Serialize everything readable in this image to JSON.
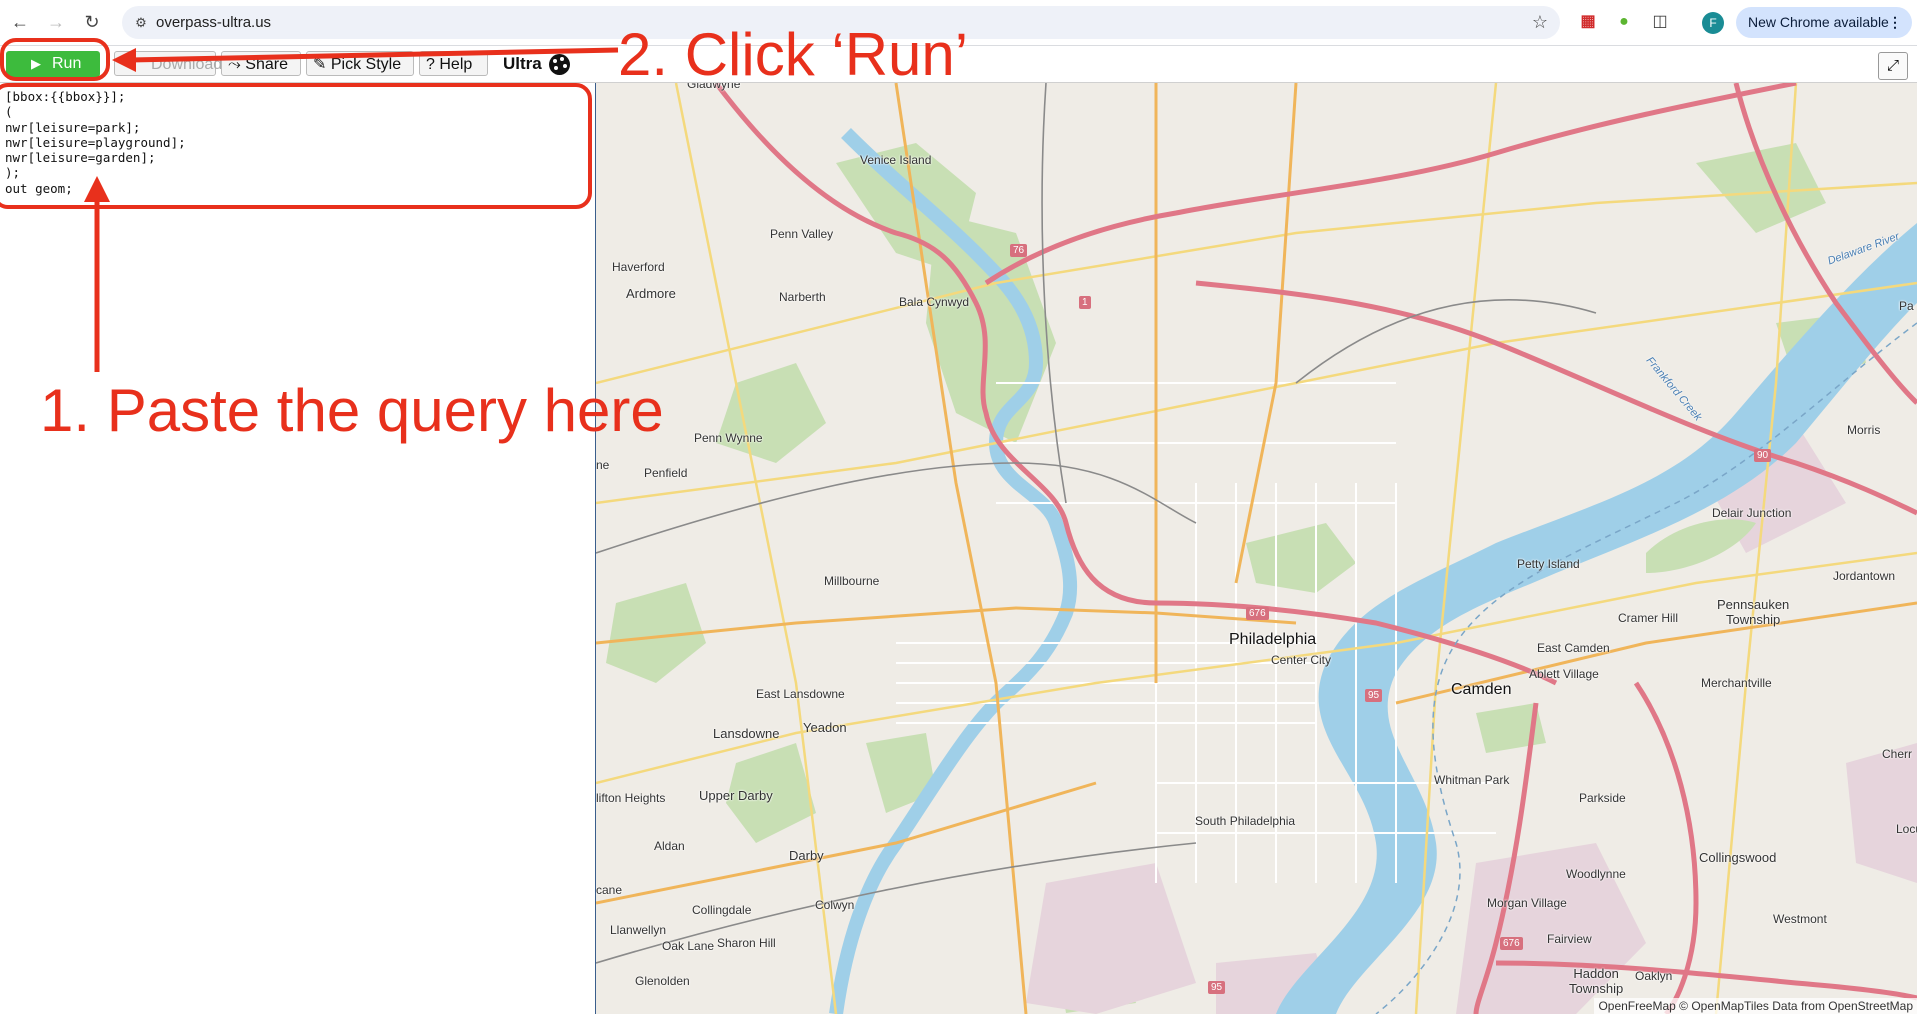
{
  "browser": {
    "url": "overpass-ultra.us",
    "profile_initial": "F",
    "update_label": "New Chrome available"
  },
  "toolbar": {
    "run_label": "Run",
    "download_label": "Download",
    "share_label": "Share",
    "pick_style_label": "Pick Style",
    "help_label": "Help",
    "ultra_label": "Ultra"
  },
  "editor": {
    "lines": [
      "[bbox:{{bbox}}];",
      "(",
      "nwr[leisure=park];",
      "nwr[leisure=playground];",
      "nwr[leisure=garden];",
      ");",
      "out geom;"
    ]
  },
  "annotations": {
    "step1": "1. Paste the query here",
    "step2": "2. Click ‘Run’",
    "color": "#e8301c"
  },
  "map": {
    "labels": {
      "gladwyne": "Gladwyne",
      "venice_island": "Venice Island",
      "penn_valley": "Penn Valley",
      "haverford": "Haverford",
      "ardmore": "Ardmore",
      "narberth": "Narberth",
      "bala_cynwyd": "Bala Cynwyd",
      "penn_wynne": "Penn Wynne",
      "penfield": "Penfield",
      "millbourne": "Millbourne",
      "east_lansdowne": "East Lansdowne",
      "lansdowne": "Lansdowne",
      "yeadon": "Yeadon",
      "clifton_heights": "lifton Heights",
      "upper_darby": "Upper Darby",
      "aldan": "Aldan",
      "darby": "Darby",
      "colwyn": "Colwyn",
      "collingdale": "Collingdale",
      "llanwellyn": "Llanwellyn",
      "oak_lane": "Oak Lane",
      "sharon_hill": "Sharon Hill",
      "glenolden": "Glenolden",
      "cane": "cane",
      "philadelphia": "Philadelphia",
      "center_city": "Center City",
      "south_philadelphia": "South Philadelphia",
      "camden": "Camden",
      "east_camden": "East Camden",
      "ablett_village": "Ablett Village",
      "cramer_hill": "Cramer Hill",
      "petty_island": "Petty Island",
      "pennsauken_township": "Pennsauken\nTownship",
      "merchantville": "Merchantville",
      "whitman_park": "Whitman Park",
      "parkside": "Parkside",
      "woodlynne": "Woodlynne",
      "collingswood": "Collingswood",
      "morgan_village": "Morgan Village",
      "fairview": "Fairview",
      "haddon_township": "Haddon\nTownship",
      "oaklyn": "Oaklyn",
      "westmont": "Westmont",
      "delair_junction": "Delair Junction",
      "jordantown": "Jordantown",
      "morris": "Morris",
      "cherry": "Cherr",
      "locust": "Locu",
      "pa": "Pa",
      "ne": "ne",
      "frankford_creek": "Frankford Creek",
      "delaware_river": "Delaware River"
    },
    "shields": {
      "i76": "76",
      "us1": "1",
      "i676a": "676",
      "i95a": "95",
      "i90": "90",
      "i676b": "676",
      "i95b": "95"
    },
    "attribution": "OpenFreeMap © OpenMapTiles Data from OpenStreetMap"
  }
}
